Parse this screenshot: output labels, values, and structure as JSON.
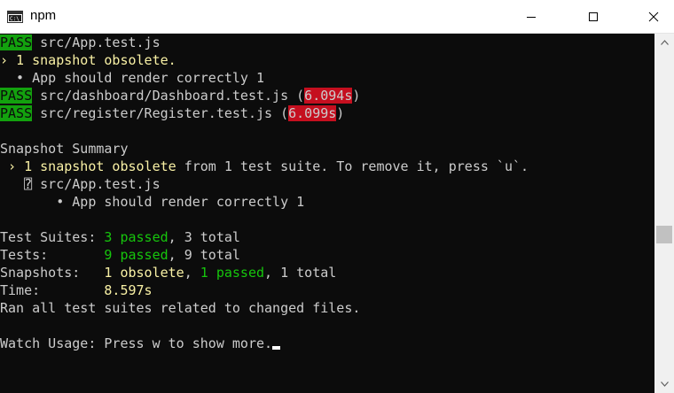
{
  "window": {
    "title": "npm"
  },
  "console": {
    "lines": [
      {
        "pass": "PASS",
        "text": " src/App.test.js"
      },
      {
        "prefix": "› 1 snapshot obsolete."
      },
      {
        "text": "  • App should render correctly 1"
      },
      {
        "pass": "PASS",
        "text": " src/dashboard/Dashboard.test.js (",
        "time": "6.094s",
        "suffix": ")"
      },
      {
        "pass": "PASS",
        "text": " src/register/Register.test.js (",
        "time": "6.099s",
        "suffix": ")"
      },
      {
        "text": ""
      },
      {
        "text": "Snapshot Summary"
      },
      {
        "prefix": " › 1 snapshot obsolete",
        "text": " from 1 test suite. To remove it, press `u`."
      },
      {
        "text": "   ⍰ src/App.test.js"
      },
      {
        "text": "       • App should render correctly 1"
      },
      {
        "text": ""
      },
      {
        "label": "Test Suites: ",
        "green": "3 passed",
        "rest": ", 3 total"
      },
      {
        "label": "Tests:       ",
        "green": "9 passed",
        "rest": ", 9 total"
      },
      {
        "label": "Snapshots:   ",
        "yellow": "1 obsolete",
        "mid": ", ",
        "green": "1 passed",
        "rest": ", 1 total"
      },
      {
        "label": "Time:        ",
        "rest": "8.597s"
      },
      {
        "text": "Ran all test suites related to changed files."
      },
      {
        "text": ""
      },
      {
        "label": "Watch Usage: ",
        "rest": "Press w to show more."
      }
    ]
  }
}
